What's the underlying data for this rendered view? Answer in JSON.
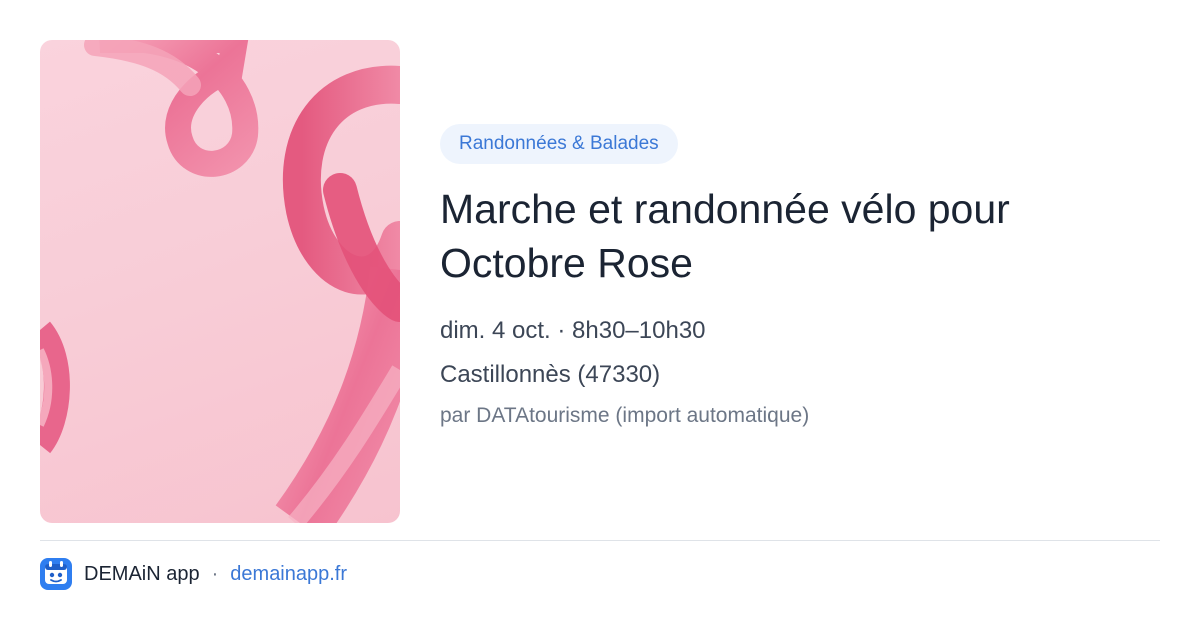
{
  "image": {
    "subject": "pink-ribbon",
    "colors": {
      "background": "#f8cdd7",
      "ribbon": "#f08aa5",
      "ribbon_shade": "#e2557c"
    }
  },
  "event": {
    "category": "Randonnées & Balades",
    "title": "Marche et randonnée vélo pour Octobre Rose",
    "when": "dim. 4 oct. · 8h30–10h30",
    "where": "Castillonnès (47330)",
    "source": "par DATAtourisme (import automatique)"
  },
  "footer": {
    "app_name": "DEMAiN app",
    "separator": "·",
    "link": "demainapp.fr",
    "logo_icon": "demain-app-logo-icon"
  },
  "colors": {
    "accent": "#3b78d6",
    "pill_background": "#eef4fd",
    "title": "#1b2433",
    "muted": "#6c7686"
  }
}
